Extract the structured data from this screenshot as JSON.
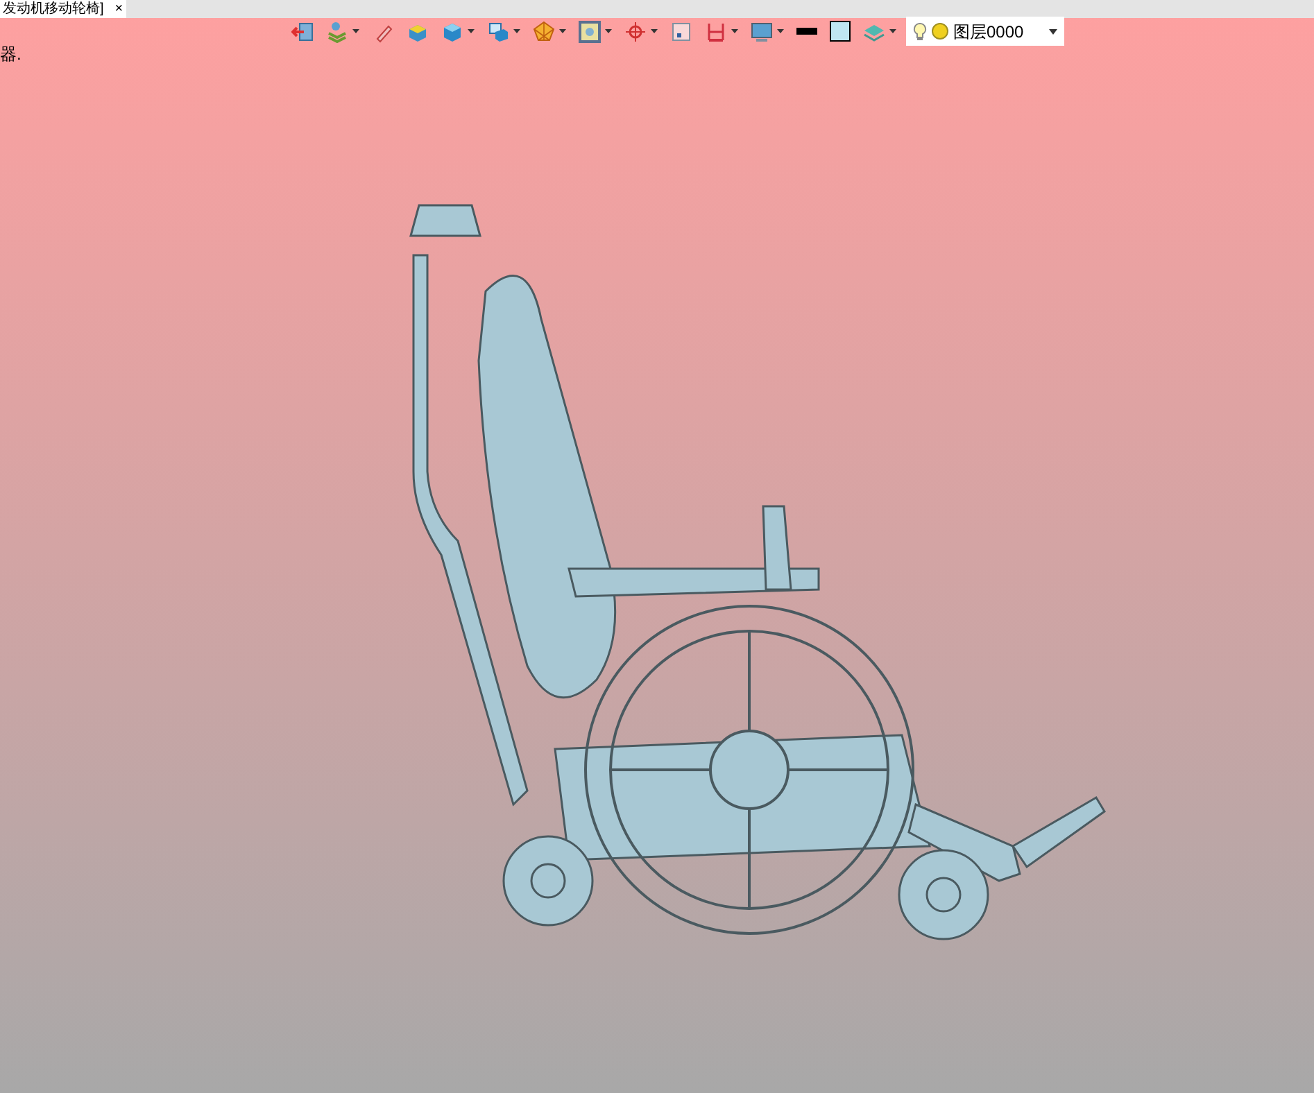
{
  "document_tab": {
    "title": "发动机移动轮椅]",
    "close": "×"
  },
  "status_text": "器.",
  "toolbar": [
    {
      "kind": "button",
      "dropdown": false
    },
    {
      "kind": "button",
      "dropdown": true
    },
    {
      "kind": "button",
      "dropdown": false
    },
    {
      "kind": "button",
      "dropdown": false
    },
    {
      "kind": "button",
      "dropdown": true
    },
    {
      "kind": "button",
      "dropdown": true
    },
    {
      "kind": "button",
      "dropdown": true
    },
    {
      "kind": "button",
      "dropdown": true
    },
    {
      "kind": "button",
      "dropdown": true
    },
    {
      "kind": "button",
      "dropdown": false
    },
    {
      "kind": "button",
      "dropdown": true
    },
    {
      "kind": "button",
      "dropdown": true
    },
    {
      "kind": "swatch",
      "color": "#000000"
    },
    {
      "kind": "swatch",
      "color": "#bfe6f2"
    },
    {
      "kind": "button",
      "dropdown": true
    }
  ],
  "layer_select": {
    "value": "图层0000"
  }
}
